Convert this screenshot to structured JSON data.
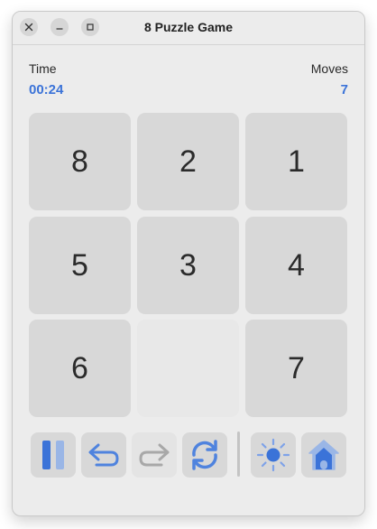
{
  "window": {
    "title": "8 Puzzle Game"
  },
  "stats": {
    "time_label": "Time",
    "time_value": "00:24",
    "moves_label": "Moves",
    "moves_value": "7"
  },
  "board": {
    "tiles": [
      "8",
      "2",
      "1",
      "5",
      "3",
      "4",
      "6",
      "",
      "7"
    ]
  },
  "toolbar": {
    "buttons": [
      {
        "icon": "pause-icon",
        "enabled": true
      },
      {
        "icon": "undo-icon",
        "enabled": true
      },
      {
        "icon": "redo-icon",
        "enabled": false
      },
      {
        "icon": "refresh-icon",
        "enabled": true
      },
      {
        "icon": "sun-icon",
        "enabled": true
      },
      {
        "icon": "home-icon",
        "enabled": true
      }
    ]
  },
  "colors": {
    "accent": "#3b73d8",
    "tile_bg": "#d8d8d8",
    "empty_tile_bg": "#e8e8e8",
    "window_bg": "#ececec"
  }
}
